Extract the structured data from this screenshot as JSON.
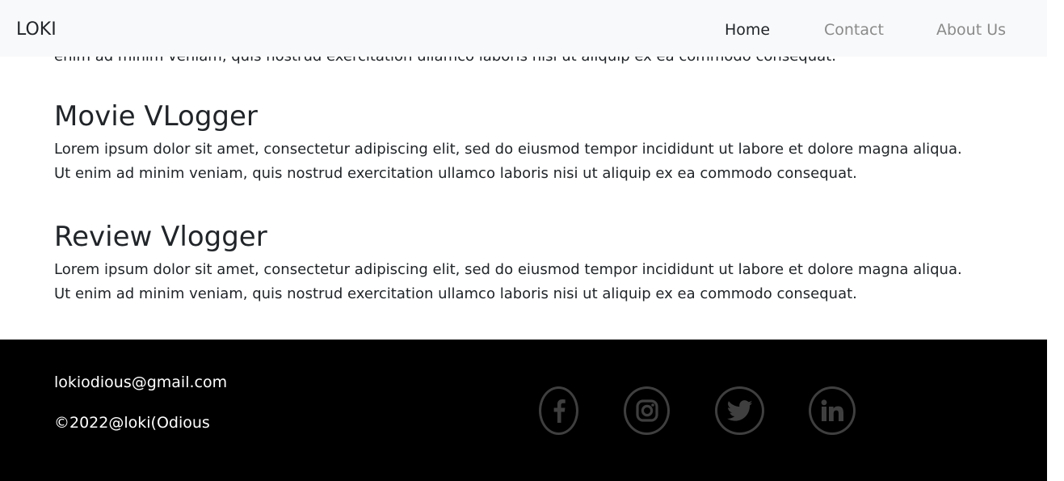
{
  "navbar": {
    "brand": "LOKI",
    "links": [
      {
        "label": "Home"
      },
      {
        "label": "Contact"
      },
      {
        "label": "About Us"
      }
    ]
  },
  "main": {
    "cut_off_line": "enim ad minim veniam, quis nostrud exercitation ullamco laboris nisi ut aliquip ex ea commodo consequat.",
    "sections": [
      {
        "title": "Movie VLogger",
        "body": "Lorem ipsum dolor sit amet, consectetur adipiscing elit, sed do eiusmod tempor incididunt ut labore et dolore magna aliqua. Ut enim ad minim veniam, quis nostrud exercitation ullamco laboris nisi ut aliquip ex ea commodo consequat."
      },
      {
        "title": "Review Vlogger",
        "body": "Lorem ipsum dolor sit amet, consectetur adipiscing elit, sed do eiusmod tempor incididunt ut labore et dolore magna aliqua. Ut enim ad minim veniam, quis nostrud exercitation ullamco laboris nisi ut aliquip ex ea commodo consequat."
      }
    ]
  },
  "footer": {
    "email": "lokiodious@gmail.com",
    "copyright": "©2022@loki(Odious",
    "social": [
      {
        "icon": "facebook-icon"
      },
      {
        "icon": "instagram-icon"
      },
      {
        "icon": "twitter-icon"
      },
      {
        "icon": "linkedin-icon"
      }
    ]
  },
  "colors": {
    "navbar_bg": "#f8f9fa",
    "text": "#212529",
    "nav_muted": "#8a8a8a",
    "footer_bg": "#000000",
    "footer_text": "#ffffff",
    "social_icon": "#3f3f3f"
  }
}
